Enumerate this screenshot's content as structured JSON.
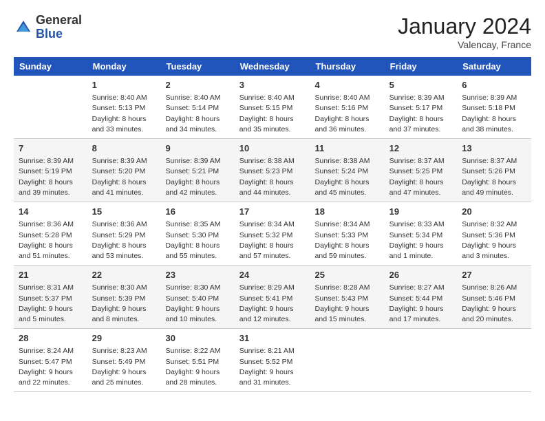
{
  "header": {
    "logo_general": "General",
    "logo_blue": "Blue",
    "month_year": "January 2024",
    "location": "Valencay, France"
  },
  "weekdays": [
    "Sunday",
    "Monday",
    "Tuesday",
    "Wednesday",
    "Thursday",
    "Friday",
    "Saturday"
  ],
  "weeks": [
    [
      {
        "day": "",
        "sunrise": "",
        "sunset": "",
        "daylight": ""
      },
      {
        "day": "1",
        "sunrise": "Sunrise: 8:40 AM",
        "sunset": "Sunset: 5:13 PM",
        "daylight": "Daylight: 8 hours and 33 minutes."
      },
      {
        "day": "2",
        "sunrise": "Sunrise: 8:40 AM",
        "sunset": "Sunset: 5:14 PM",
        "daylight": "Daylight: 8 hours and 34 minutes."
      },
      {
        "day": "3",
        "sunrise": "Sunrise: 8:40 AM",
        "sunset": "Sunset: 5:15 PM",
        "daylight": "Daylight: 8 hours and 35 minutes."
      },
      {
        "day": "4",
        "sunrise": "Sunrise: 8:40 AM",
        "sunset": "Sunset: 5:16 PM",
        "daylight": "Daylight: 8 hours and 36 minutes."
      },
      {
        "day": "5",
        "sunrise": "Sunrise: 8:39 AM",
        "sunset": "Sunset: 5:17 PM",
        "daylight": "Daylight: 8 hours and 37 minutes."
      },
      {
        "day": "6",
        "sunrise": "Sunrise: 8:39 AM",
        "sunset": "Sunset: 5:18 PM",
        "daylight": "Daylight: 8 hours and 38 minutes."
      }
    ],
    [
      {
        "day": "7",
        "sunrise": "Sunrise: 8:39 AM",
        "sunset": "Sunset: 5:19 PM",
        "daylight": "Daylight: 8 hours and 39 minutes."
      },
      {
        "day": "8",
        "sunrise": "Sunrise: 8:39 AM",
        "sunset": "Sunset: 5:20 PM",
        "daylight": "Daylight: 8 hours and 41 minutes."
      },
      {
        "day": "9",
        "sunrise": "Sunrise: 8:39 AM",
        "sunset": "Sunset: 5:21 PM",
        "daylight": "Daylight: 8 hours and 42 minutes."
      },
      {
        "day": "10",
        "sunrise": "Sunrise: 8:38 AM",
        "sunset": "Sunset: 5:23 PM",
        "daylight": "Daylight: 8 hours and 44 minutes."
      },
      {
        "day": "11",
        "sunrise": "Sunrise: 8:38 AM",
        "sunset": "Sunset: 5:24 PM",
        "daylight": "Daylight: 8 hours and 45 minutes."
      },
      {
        "day": "12",
        "sunrise": "Sunrise: 8:37 AM",
        "sunset": "Sunset: 5:25 PM",
        "daylight": "Daylight: 8 hours and 47 minutes."
      },
      {
        "day": "13",
        "sunrise": "Sunrise: 8:37 AM",
        "sunset": "Sunset: 5:26 PM",
        "daylight": "Daylight: 8 hours and 49 minutes."
      }
    ],
    [
      {
        "day": "14",
        "sunrise": "Sunrise: 8:36 AM",
        "sunset": "Sunset: 5:28 PM",
        "daylight": "Daylight: 8 hours and 51 minutes."
      },
      {
        "day": "15",
        "sunrise": "Sunrise: 8:36 AM",
        "sunset": "Sunset: 5:29 PM",
        "daylight": "Daylight: 8 hours and 53 minutes."
      },
      {
        "day": "16",
        "sunrise": "Sunrise: 8:35 AM",
        "sunset": "Sunset: 5:30 PM",
        "daylight": "Daylight: 8 hours and 55 minutes."
      },
      {
        "day": "17",
        "sunrise": "Sunrise: 8:34 AM",
        "sunset": "Sunset: 5:32 PM",
        "daylight": "Daylight: 8 hours and 57 minutes."
      },
      {
        "day": "18",
        "sunrise": "Sunrise: 8:34 AM",
        "sunset": "Sunset: 5:33 PM",
        "daylight": "Daylight: 8 hours and 59 minutes."
      },
      {
        "day": "19",
        "sunrise": "Sunrise: 8:33 AM",
        "sunset": "Sunset: 5:34 PM",
        "daylight": "Daylight: 9 hours and 1 minute."
      },
      {
        "day": "20",
        "sunrise": "Sunrise: 8:32 AM",
        "sunset": "Sunset: 5:36 PM",
        "daylight": "Daylight: 9 hours and 3 minutes."
      }
    ],
    [
      {
        "day": "21",
        "sunrise": "Sunrise: 8:31 AM",
        "sunset": "Sunset: 5:37 PM",
        "daylight": "Daylight: 9 hours and 5 minutes."
      },
      {
        "day": "22",
        "sunrise": "Sunrise: 8:30 AM",
        "sunset": "Sunset: 5:39 PM",
        "daylight": "Daylight: 9 hours and 8 minutes."
      },
      {
        "day": "23",
        "sunrise": "Sunrise: 8:30 AM",
        "sunset": "Sunset: 5:40 PM",
        "daylight": "Daylight: 9 hours and 10 minutes."
      },
      {
        "day": "24",
        "sunrise": "Sunrise: 8:29 AM",
        "sunset": "Sunset: 5:41 PM",
        "daylight": "Daylight: 9 hours and 12 minutes."
      },
      {
        "day": "25",
        "sunrise": "Sunrise: 8:28 AM",
        "sunset": "Sunset: 5:43 PM",
        "daylight": "Daylight: 9 hours and 15 minutes."
      },
      {
        "day": "26",
        "sunrise": "Sunrise: 8:27 AM",
        "sunset": "Sunset: 5:44 PM",
        "daylight": "Daylight: 9 hours and 17 minutes."
      },
      {
        "day": "27",
        "sunrise": "Sunrise: 8:26 AM",
        "sunset": "Sunset: 5:46 PM",
        "daylight": "Daylight: 9 hours and 20 minutes."
      }
    ],
    [
      {
        "day": "28",
        "sunrise": "Sunrise: 8:24 AM",
        "sunset": "Sunset: 5:47 PM",
        "daylight": "Daylight: 9 hours and 22 minutes."
      },
      {
        "day": "29",
        "sunrise": "Sunrise: 8:23 AM",
        "sunset": "Sunset: 5:49 PM",
        "daylight": "Daylight: 9 hours and 25 minutes."
      },
      {
        "day": "30",
        "sunrise": "Sunrise: 8:22 AM",
        "sunset": "Sunset: 5:51 PM",
        "daylight": "Daylight: 9 hours and 28 minutes."
      },
      {
        "day": "31",
        "sunrise": "Sunrise: 8:21 AM",
        "sunset": "Sunset: 5:52 PM",
        "daylight": "Daylight: 9 hours and 31 minutes."
      },
      {
        "day": "",
        "sunrise": "",
        "sunset": "",
        "daylight": ""
      },
      {
        "day": "",
        "sunrise": "",
        "sunset": "",
        "daylight": ""
      },
      {
        "day": "",
        "sunrise": "",
        "sunset": "",
        "daylight": ""
      }
    ]
  ]
}
